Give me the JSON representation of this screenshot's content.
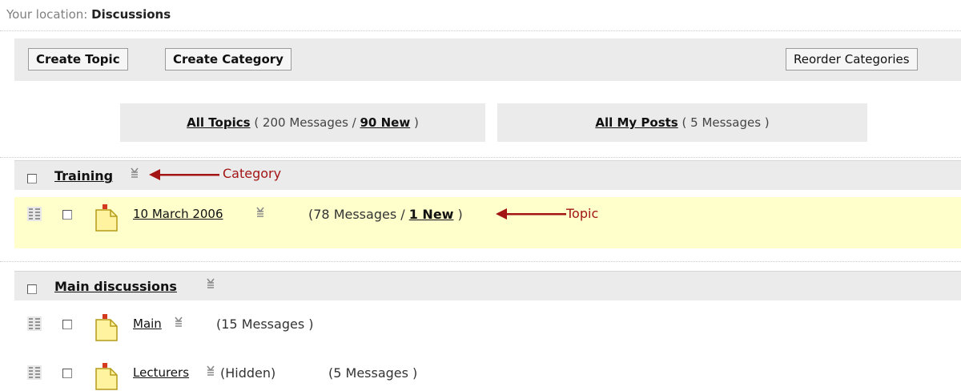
{
  "breadcrumb": {
    "prefix": "Your location:",
    "current": "Discussions"
  },
  "toolbar": {
    "create_topic": "Create Topic",
    "create_category": "Create Category",
    "reorder_categories": "Reorder Categories"
  },
  "summary": {
    "all_topics": {
      "label": "All Topics",
      "before": "( 200 Messages /",
      "new_link": "90 New",
      "after": ")"
    },
    "all_my_posts": {
      "label": "All My Posts",
      "text": "( 5 Messages )"
    }
  },
  "categories": [
    {
      "name": "Training",
      "annotation": "Category",
      "topics": [
        {
          "name": "10 March 2006",
          "before": "(78 Messages /",
          "new_link": "1 New",
          "after": ")",
          "annotation": "Topic"
        }
      ]
    },
    {
      "name": "Main discussions",
      "topics": [
        {
          "name": "Main",
          "messages": "(15 Messages )"
        },
        {
          "name": "Lecturers",
          "status": "(Hidden)",
          "messages": "(5 Messages )"
        }
      ]
    }
  ],
  "colors": {
    "annotation": "#a31515",
    "topic_highlight": "#ffffcc",
    "bar": "#ebebeb"
  },
  "icons": [
    "sort-icon",
    "move-handle-icon",
    "document-icon",
    "checkbox"
  ]
}
